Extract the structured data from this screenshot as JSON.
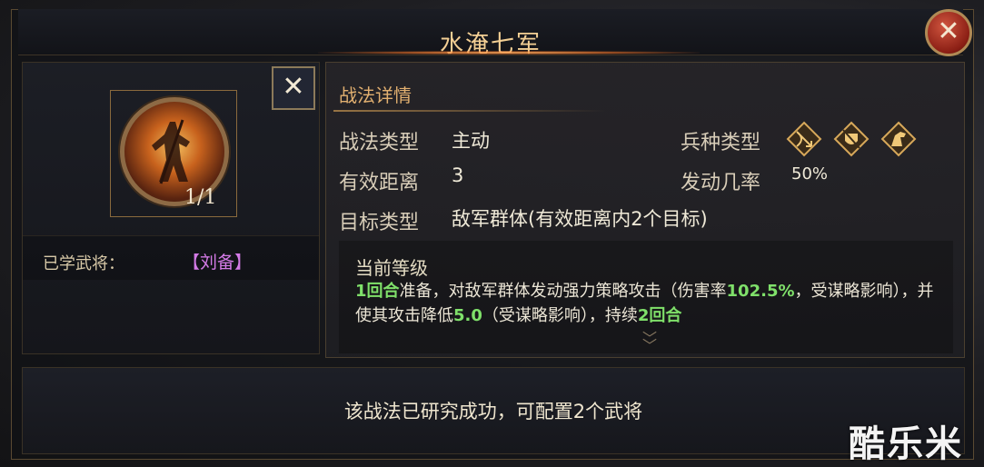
{
  "dialog": {
    "title": "水淹七军",
    "close_icon": "close-icon"
  },
  "skill": {
    "icon": "skill-portrait-icon",
    "count": "1/1",
    "remove_icon": "close-icon",
    "learned_label": "已学武将：",
    "learned_general": "【刘备】"
  },
  "details": {
    "section_title": "战法详情",
    "type_label": "战法类型",
    "type_value": "主动",
    "range_label": "有效距离",
    "range_value": "3",
    "target_label": "目标类型",
    "target_value": "敌军群体(有效距离内2个目标)",
    "unit_label": "兵种类型",
    "unit_icons": [
      "archer-unit-icon",
      "infantry-unit-icon",
      "cavalry-unit-icon"
    ],
    "rate_label": "发动几率",
    "rate_value": "50%"
  },
  "level": {
    "title": "当前等级",
    "desc_p1": "1回合",
    "desc_p2": "准备，对敌军群体发动强力策略攻击（伤害率",
    "desc_p3": "102.5%",
    "desc_p4": "，受谋略影响），并使其攻击降低",
    "desc_p5": "5.0",
    "desc_p6": "（受谋略影响），持续",
    "desc_p7": "2回合",
    "more_icon": "chevron-down-icon"
  },
  "footer": {
    "status": "该战法已研究成功，可配置2个武将"
  },
  "watermark": "酷乐米",
  "colors": {
    "title": "#f3cf94",
    "highlight": "#7fe06a",
    "general_name": "#d37ae6",
    "section_title": "#e2b070"
  }
}
